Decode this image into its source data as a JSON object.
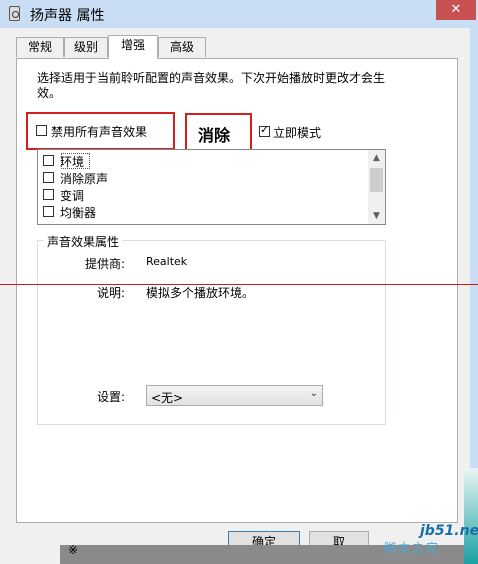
{
  "window": {
    "title": "扬声器 属性",
    "close_label": "✕"
  },
  "tabs": [
    {
      "label": "常规"
    },
    {
      "label": "级别"
    },
    {
      "label": "增强"
    },
    {
      "label": "高级"
    }
  ],
  "active_tab": "增强",
  "enhance": {
    "description": "选择适用于当前聆听配置的声音效果。下次开始播放时更改才会生效。",
    "disable_all_label": "禁用所有声音效果",
    "disable_all_checked": false,
    "annotation_label": "消除",
    "immediate_mode_label": "立即模式",
    "immediate_mode_checked": true,
    "effects": [
      {
        "label": "环境",
        "checked": false
      },
      {
        "label": "消除原声",
        "checked": false
      },
      {
        "label": "变调",
        "checked": false
      },
      {
        "label": "均衡器",
        "checked": false
      }
    ],
    "properties": {
      "group_title": "声音效果属性",
      "provider_label": "提供商:",
      "provider_value": "Realtek",
      "desc_label": "说明:",
      "desc_value": "模拟多个播放环境。",
      "settings_label": "设置:",
      "settings_value": "<无>"
    }
  },
  "buttons": {
    "ok": "确定",
    "cancel": "取"
  },
  "overlay": {
    "text": "※"
  },
  "watermark": {
    "site": "jb51.net",
    "sub": "脚本之家"
  },
  "colors": {
    "titlebar": "#c9def5",
    "close": "#c75050",
    "annotation_red": "#d41f1f"
  }
}
